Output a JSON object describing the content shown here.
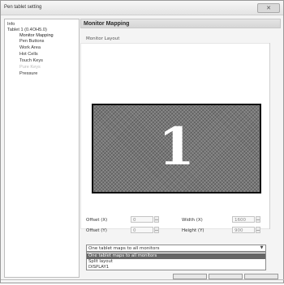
{
  "window": {
    "title": "Pen tablet setting",
    "close_label": "✕"
  },
  "sidebar": {
    "items": [
      {
        "label": "Info"
      },
      {
        "label": "Tablet 1 (0.4OH5.0)"
      },
      {
        "label": "Monitor Mapping"
      },
      {
        "label": "Pen Buttons"
      },
      {
        "label": "Work Area"
      },
      {
        "label": "Hot Cells"
      },
      {
        "label": "Touch Keys"
      },
      {
        "label": "Pure Keys"
      },
      {
        "label": "Pressure"
      }
    ]
  },
  "main": {
    "section_title": "Monitor Mapping",
    "layout_label": "Monitor Layout",
    "monitor_number": "1",
    "fields": {
      "offset_x": {
        "label": "Offset (X)",
        "value": "0"
      },
      "offset_y": {
        "label": "Offset (Y)",
        "value": "0"
      },
      "width": {
        "label": "Width (X)",
        "value": "1600"
      },
      "height": {
        "label": "Height (Y)",
        "value": "900"
      }
    },
    "mapping_select": {
      "value": "One tablet maps to all monitors",
      "options": [
        "One tablet maps to all monitors",
        "Split layout",
        "DISPLAY1"
      ],
      "highlighted_index": 0
    }
  },
  "colors": {
    "monitor_border": "#0f0f0f",
    "monitor_fill": "#777777",
    "highlight": "#666666"
  }
}
